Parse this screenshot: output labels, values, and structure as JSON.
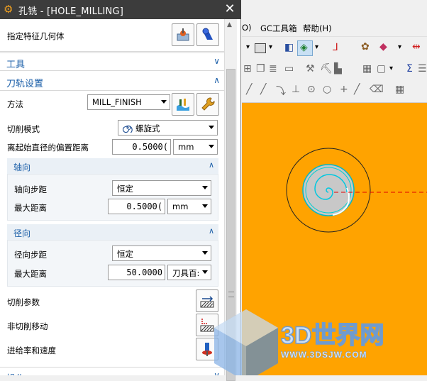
{
  "window": {
    "title": "孔铣 - [HOLE_MILLING]"
  },
  "geometry": {
    "label": "指定特征几何体"
  },
  "sections": {
    "tool": "工具",
    "toolpath": "刀轨设置"
  },
  "method": {
    "label": "方法",
    "value": "MILL_FINISH"
  },
  "cut_pattern": {
    "label": "切削模式",
    "value": "螺旋式"
  },
  "offset": {
    "label": "离起始直径的偏置距离",
    "value": "0.5000(",
    "unit": "mm"
  },
  "axial": {
    "title": "轴向",
    "step_label": "轴向步距",
    "step_value": "恒定",
    "max_label": "最大距离",
    "max_value": "0.5000(",
    "max_unit": "mm"
  },
  "radial": {
    "title": "径向",
    "step_label": "径向步距",
    "step_value": "恒定",
    "max_label": "最大距离",
    "max_value": "50.0000",
    "max_unit": "刀具百:"
  },
  "params": {
    "cut_params": "切削参数",
    "non_cut": "非切削移动",
    "feeds": "进给率和速度",
    "bottom": "操作"
  },
  "menu": {
    "item1": "O)",
    "item2": "GC工具箱",
    "item3": "帮助(H)"
  },
  "watermark": {
    "logo": "3D世界网",
    "url": "WWW.3DSJW.COM"
  }
}
